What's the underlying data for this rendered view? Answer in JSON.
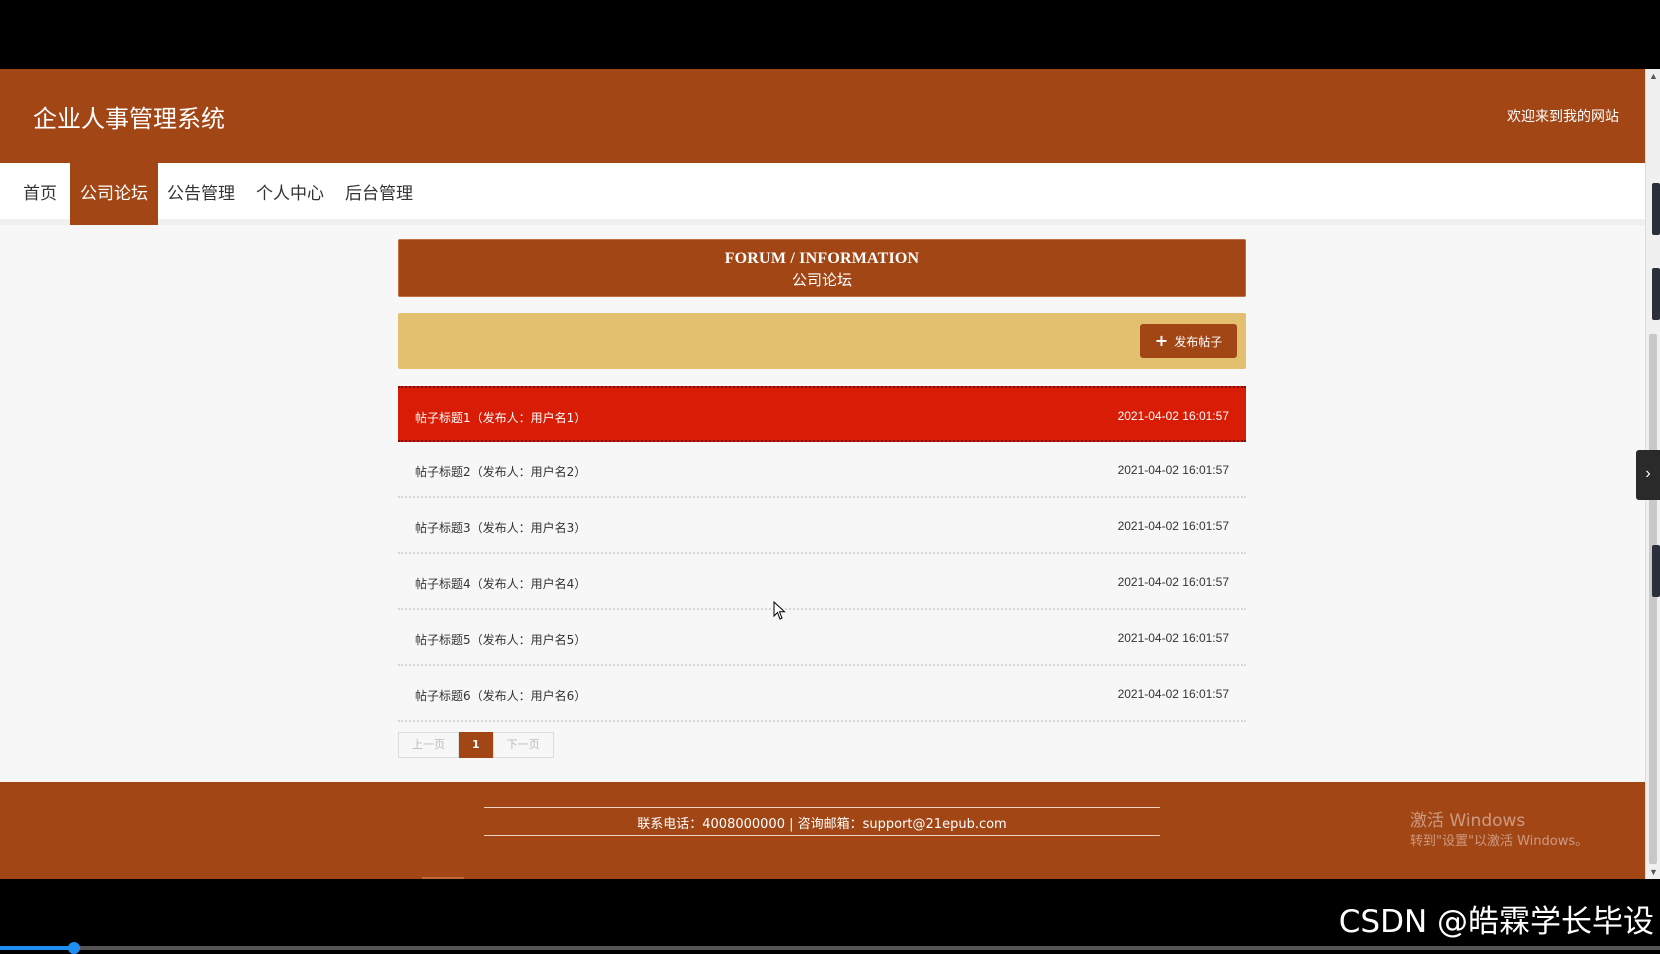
{
  "header": {
    "site_title": "企业人事管理系统",
    "welcome": "欢迎来到我的网站"
  },
  "nav": {
    "items": [
      {
        "label": "首页",
        "active": false
      },
      {
        "label": "公司论坛",
        "active": true
      },
      {
        "label": "公告管理",
        "active": false
      },
      {
        "label": "个人中心",
        "active": false
      },
      {
        "label": "后台管理",
        "active": false
      }
    ]
  },
  "banner": {
    "en": "FORUM / INFORMATION",
    "cn": "公司论坛"
  },
  "toolbar": {
    "post_button": "发布帖子",
    "post_icon": "plus-icon"
  },
  "posts": [
    {
      "title": "帖子标题1（发布人：用户名1）",
      "time": "2021-04-02 16:01:57",
      "highlighted": true
    },
    {
      "title": "帖子标题2（发布人：用户名2）",
      "time": "2021-04-02 16:01:57",
      "highlighted": false
    },
    {
      "title": "帖子标题3（发布人：用户名3）",
      "time": "2021-04-02 16:01:57",
      "highlighted": false
    },
    {
      "title": "帖子标题4（发布人：用户名4）",
      "time": "2021-04-02 16:01:57",
      "highlighted": false
    },
    {
      "title": "帖子标题5（发布人：用户名5）",
      "time": "2021-04-02 16:01:57",
      "highlighted": false
    },
    {
      "title": "帖子标题6（发布人：用户名6）",
      "time": "2021-04-02 16:01:57",
      "highlighted": false
    }
  ],
  "pager": {
    "prev": "上一页",
    "current": "1",
    "next": "下一页"
  },
  "footer": {
    "contact": "联系电话：4008000000 | 咨询邮箱：support@21epub.com"
  },
  "watermark": {
    "line1": "激活 Windows",
    "line2": "转到\"设置\"以激活 Windows。"
  },
  "overlay": {
    "csdn": "CSDN @皓霖学长毕设"
  },
  "colors": {
    "brand": "#a24616",
    "highlight_row": "#d81c06",
    "toolbar_bg": "#e2c070"
  }
}
